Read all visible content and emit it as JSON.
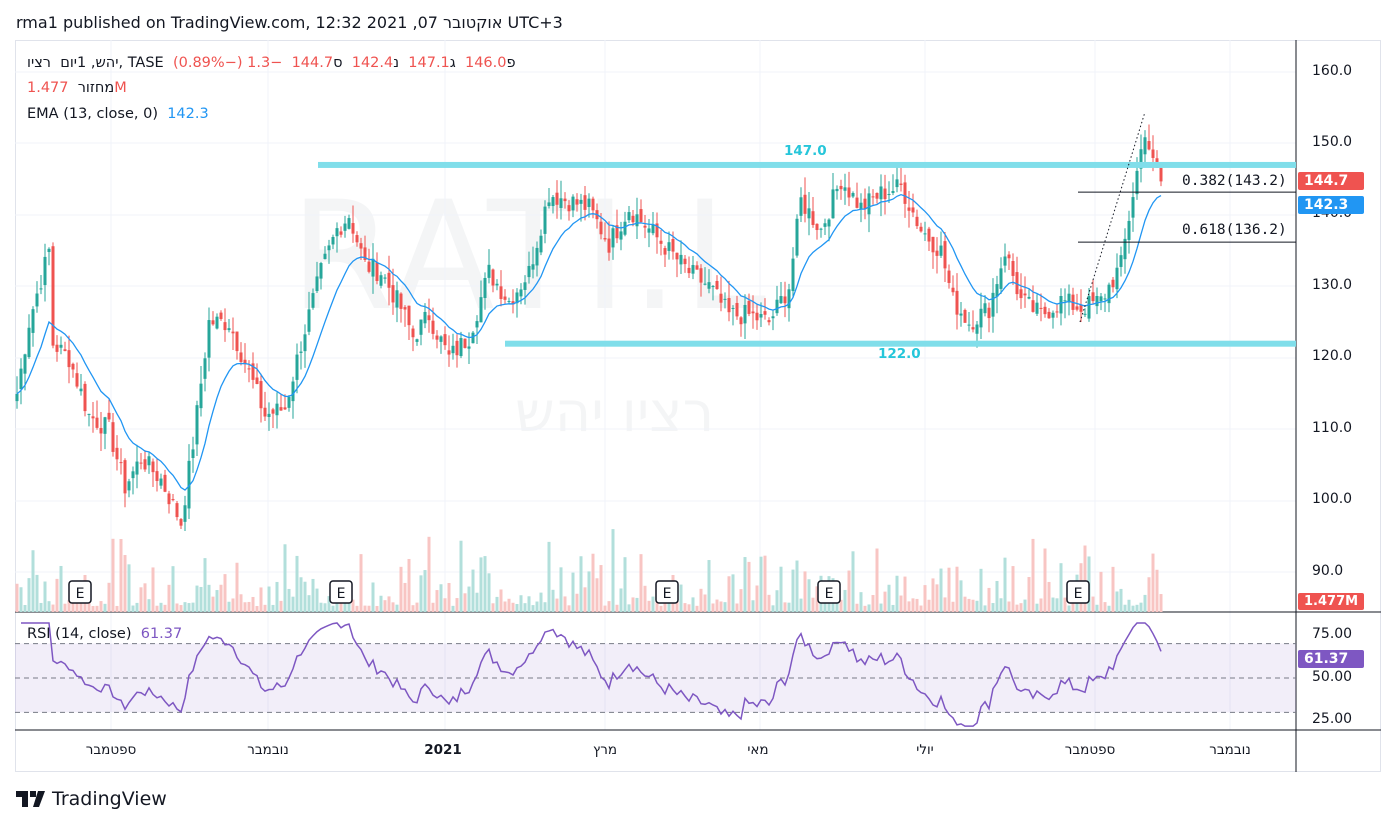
{
  "header": {
    "published": "rma1 published on TradingView.com, 12:32 2021 ,07 אוקטובר UTC+3"
  },
  "legend": {
    "symbol": "יהש, 1יום",
    "name": "רציו, TASE",
    "open_label": "פ",
    "open": "146.0",
    "high_label": "ג",
    "high": "147.1",
    "low_label": "נ",
    "low": "142.4",
    "close_label": "ס",
    "close": "144.7",
    "change": "−1.3 (−0.89%)",
    "volume_label": "מחזור",
    "volume": "1.477M",
    "ema_label": "EMA (13, close, 0)",
    "ema": "142.3",
    "rsi_label": "RSI (14, close)",
    "rsi": "61.37"
  },
  "watermark": {
    "ticker": "RATI.L",
    "name": "רציו יהש"
  },
  "price_axis": {
    "ticks": [
      "160.0",
      "150.0",
      "140.0",
      "130.0",
      "120.0",
      "110.0",
      "100.0",
      "90.0"
    ],
    "last_price": "144.7",
    "ema_tag": "142.3",
    "volume_tag": "1.477M"
  },
  "rsi_axis": {
    "ticks": [
      "75.00",
      "50.00",
      "25.00"
    ],
    "rsi_tag": "61.37"
  },
  "time_axis": {
    "labels": [
      "ספטמבר",
      "נובמבר",
      "2021",
      "מרץ",
      "מאי",
      "יולי",
      "ספטמבר",
      "נובמבר"
    ]
  },
  "levels": {
    "resistance": "147.0",
    "support": "122.0",
    "fib382": "0.382(143.2)",
    "fib618": "0.618(136.2)"
  },
  "earnings_marker": "E",
  "colors": {
    "up": "#26a69a",
    "down": "#ef5350",
    "ema": "#2196f3",
    "rsi": "#7e57c2",
    "level": "#80deea"
  },
  "footer": {
    "brand": "TradingView"
  },
  "chart_data": {
    "type": "candlestick",
    "title": "רציו, TASE, 1D",
    "ylim": [
      86,
      164
    ],
    "levels": [
      147.0,
      122.0
    ],
    "fib": [
      {
        "ratio": 0.382,
        "price": 143.2
      },
      {
        "ratio": 0.618,
        "price": 136.2
      }
    ],
    "close_keypoints": [
      [
        0,
        115
      ],
      [
        3,
        125
      ],
      [
        8,
        135
      ],
      [
        9,
        122
      ],
      [
        13,
        120
      ],
      [
        18,
        112
      ],
      [
        23,
        110
      ],
      [
        27,
        102
      ],
      [
        31,
        106
      ],
      [
        36,
        103
      ],
      [
        41,
        97
      ],
      [
        44,
        108
      ],
      [
        48,
        125
      ],
      [
        53,
        125
      ],
      [
        58,
        118
      ],
      [
        62,
        112
      ],
      [
        67,
        113
      ],
      [
        71,
        122
      ],
      [
        76,
        132
      ],
      [
        80,
        138
      ],
      [
        83,
        140
      ],
      [
        87,
        133
      ],
      [
        91,
        132
      ],
      [
        96,
        127
      ],
      [
        99,
        123
      ],
      [
        103,
        126
      ],
      [
        108,
        120
      ],
      [
        113,
        123
      ],
      [
        118,
        132
      ],
      [
        123,
        128
      ],
      [
        128,
        132
      ],
      [
        133,
        143
      ],
      [
        138,
        142
      ],
      [
        143,
        141
      ],
      [
        148,
        136
      ],
      [
        153,
        141
      ],
      [
        158,
        138
      ],
      [
        163,
        135
      ],
      [
        168,
        132
      ],
      [
        173,
        130
      ],
      [
        178,
        126
      ],
      [
        183,
        126
      ],
      [
        188,
        125
      ],
      [
        193,
        130
      ],
      [
        196,
        142
      ],
      [
        201,
        138
      ],
      [
        206,
        145
      ],
      [
        211,
        141
      ],
      [
        216,
        143
      ],
      [
        221,
        144
      ],
      [
        226,
        138
      ],
      [
        231,
        135
      ],
      [
        234,
        128
      ],
      [
        238,
        125
      ],
      [
        243,
        127
      ],
      [
        247,
        135
      ],
      [
        251,
        128
      ],
      [
        256,
        126
      ],
      [
        261,
        128
      ],
      [
        266,
        127
      ],
      [
        271,
        128
      ],
      [
        276,
        133
      ],
      [
        279,
        143
      ],
      [
        282,
        152
      ],
      [
        284,
        147
      ],
      [
        286,
        144.7
      ]
    ],
    "rsi": {
      "last": 61.37,
      "bands": [
        70,
        50,
        30
      ],
      "ylim": [
        20,
        82
      ]
    },
    "ema": {
      "period": 13,
      "last": 142.3
    },
    "volume": {
      "last": "1.477M"
    }
  }
}
